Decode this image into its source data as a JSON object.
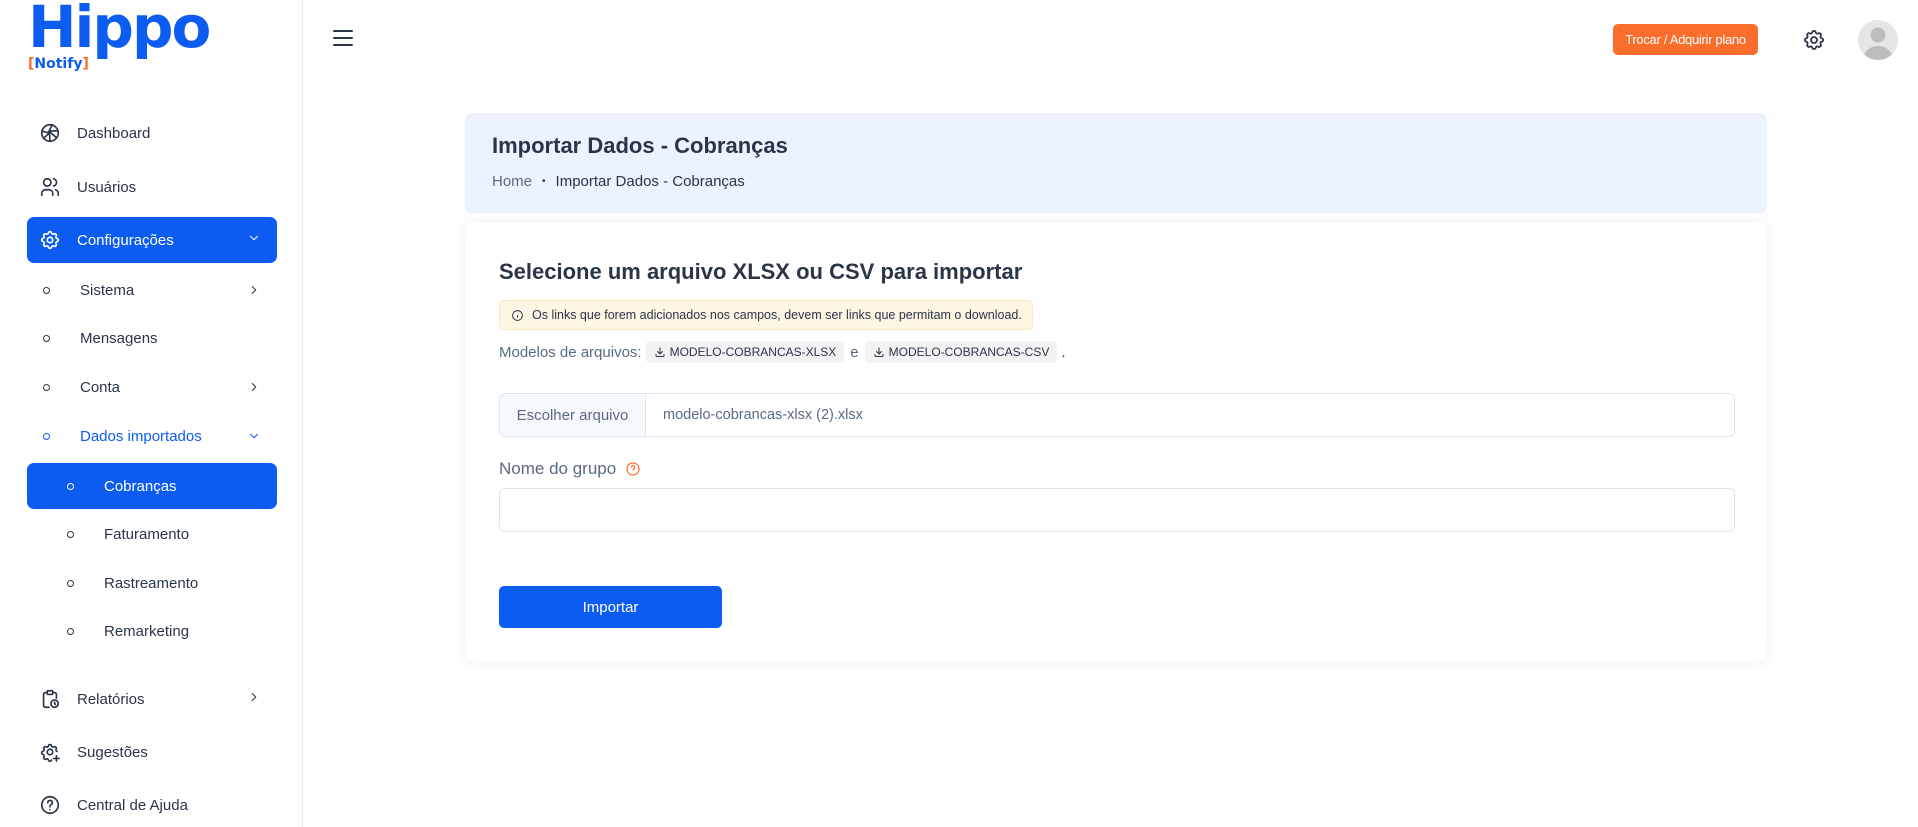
{
  "logo": {
    "main": "Hippo",
    "sub_open": "[",
    "sub": "Notify",
    "sub_close": "]"
  },
  "sidebar": {
    "items": [
      {
        "label": "Dashboard",
        "icon": "aperture-icon"
      },
      {
        "label": "Usuários",
        "icon": "users-icon"
      },
      {
        "label": "Configurações",
        "icon": "settings-icon",
        "active": true,
        "expanded": true
      },
      {
        "label": "Sistema",
        "has_children": true
      },
      {
        "label": "Mensagens"
      },
      {
        "label": "Conta",
        "has_children": true
      },
      {
        "label": "Dados importados",
        "expanded": true
      },
      {
        "label": "Cobranças",
        "active": true
      },
      {
        "label": "Faturamento"
      },
      {
        "label": "Rastreamento"
      },
      {
        "label": "Remarketing"
      },
      {
        "label": "Relatórios",
        "icon": "clipboard-clock-icon"
      },
      {
        "label": "Sugestões",
        "icon": "settings-plus-icon"
      },
      {
        "label": "Central de Ajuda",
        "icon": "help-circle-icon"
      }
    ]
  },
  "topbar": {
    "plan_button": "Trocar / Adquirir plano"
  },
  "header": {
    "title": "Importar Dados - Cobranças",
    "breadcrumb": {
      "home": "Home",
      "separator": "•",
      "current": "Importar Dados - Cobranças"
    }
  },
  "main": {
    "heading": {
      "pre": "Selecione um arquivo ",
      "fmt1": "XLSX",
      "mid": " ou ",
      "fmt2": "CSV",
      "post": " para importar"
    },
    "alert": "Os links que forem adicionados nos campos, devem ser links que permitam o download.",
    "models": {
      "label": "Modelos de arquivos:",
      "xlsx": "MODELO-COBRANCAS-XLSX",
      "and": "e",
      "csv": "MODELO-COBRANCAS-CSV",
      "end": "."
    },
    "file": {
      "button": "Escolher arquivo",
      "value": "modelo-cobrancas-xlsx (2).xlsx"
    },
    "group": {
      "label": "Nome do grupo",
      "value": ""
    },
    "import_button": "Importar"
  },
  "colors": {
    "primary": "#0d5cf2",
    "accent": "#fa6d2b",
    "header_bg": "#ecf2ff",
    "alert_bg": "#fef5e5"
  }
}
